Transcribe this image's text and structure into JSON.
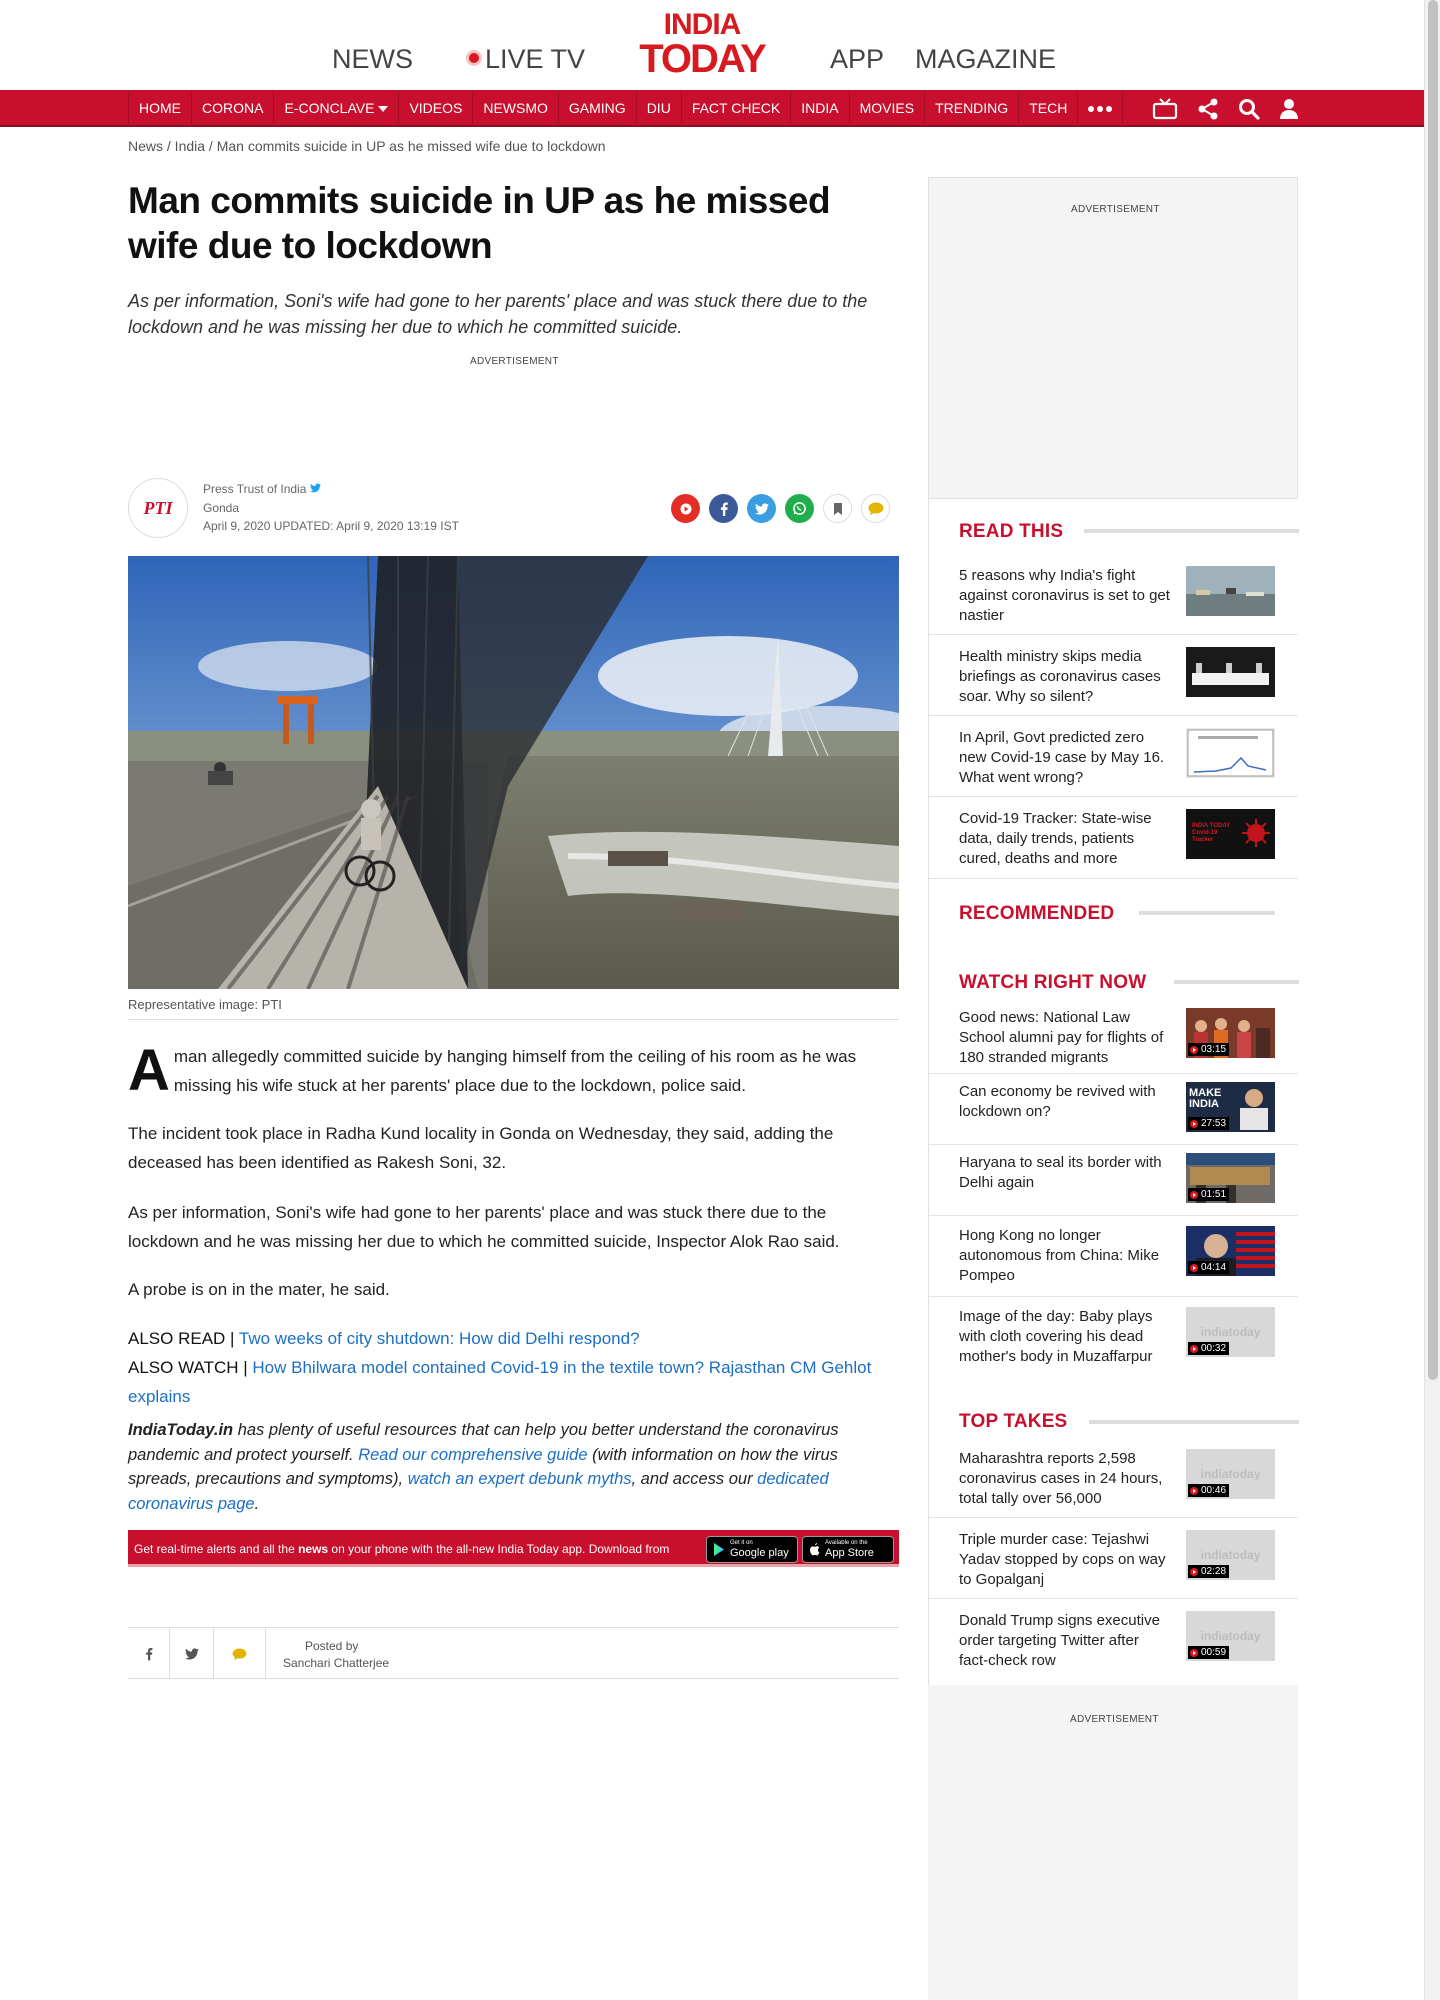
{
  "header": {
    "top_links": {
      "news": "NEWS",
      "live_tv": "LIVE TV",
      "app": "APP",
      "magazine": "MAGAZINE"
    },
    "logo": {
      "line1": "INDIA",
      "line2": "TODAY"
    },
    "brand_color": "#c8102e",
    "nav": [
      "HOME",
      "CORONA",
      "E-CONCLAVE",
      "VIDEOS",
      "NEWSMO",
      "GAMING",
      "DIU",
      "FACT CHECK",
      "INDIA",
      "MOVIES",
      "TRENDING",
      "TECH"
    ],
    "nav_icons": [
      "tv-icon",
      "share-icon",
      "search-icon",
      "user-icon"
    ]
  },
  "breadcrumb": "News / India / Man commits suicide in UP as he missed wife due to lockdown",
  "article": {
    "headline": "Man commits suicide in UP as he missed wife due to lockdown",
    "summary": "As per information, Soni's wife had gone to her parents' place and was stuck there due to the lockdown and he was missing her due to which he committed suicide.",
    "ad_label": "ADVERTISEMENT",
    "author": {
      "logo_text": "PTI",
      "name": "Press Trust of India",
      "location": "Gonda",
      "dateline": "April 9, 2020  UPDATED: April 9, 2020 13:19 IST"
    },
    "share_icons": [
      "youtube-icon",
      "facebook-icon",
      "twitter-icon",
      "whatsapp-icon",
      "bookmark-icon",
      "comment-icon"
    ],
    "image_caption": "Representative image: PTI",
    "dropcap": "A",
    "p1": "man allegedly committed suicide by hanging himself from the ceiling of his room as he was missing his wife stuck at her parents' place due to the lockdown, police said.",
    "p2": "The incident took place in Radha Kund locality in Gonda on Wednesday, they said, adding the deceased has been identified as Rakesh Soni, 32.",
    "p3": "As per information, Soni's wife had gone to her parents' place and was stuck there due to the lockdown and he was missing her due to which he committed suicide, Inspector Alok Rao said.",
    "p4": "A probe is on in the mater, he said.",
    "also_read_label": "ALSO READ |",
    "also_read_link": "Two weeks of city shutdown: How did Delhi respond?",
    "also_watch_label": "ALSO WATCH |",
    "also_watch_link": "How Bhilwara model contained Covid-19 in the textile town? Rajasthan CM Gehlot explains",
    "resources": {
      "brand": "IndiaToday.in",
      "t1": " has plenty of useful resources that can help you better understand the coronavirus pandemic and protect yourself. ",
      "link1": "Read our comprehensive guide",
      "t2": " (with information on how the virus spreads, precautions and symptoms), ",
      "link2": "watch an expert debunk myths",
      "t3": ", and access our ",
      "link3": "dedicated coronavirus page",
      "t4": "."
    },
    "app_bar": {
      "text_before": "Get real-time alerts and all the ",
      "text_bold": "news",
      "text_after": " on your phone with the all-new India Today app. Download from",
      "google_small": "Get it on",
      "google_big": "Google play",
      "apple_small": "Available on the",
      "apple_big": "App Store"
    },
    "posted_by_label": "Posted by",
    "posted_by_name": "Sanchari Chatterjee"
  },
  "sidebar": {
    "ad_label": "ADVERTISEMENT",
    "read_this": {
      "heading": "READ THIS",
      "items": [
        {
          "title": "5 reasons why India's fight against coronavirus is set to get nastier"
        },
        {
          "title": "Health ministry skips media briefings as coronavirus cases soar. Why so silent?"
        },
        {
          "title": "In April, Govt predicted zero new Covid-19 case by May 16. What went wrong?"
        },
        {
          "title": "Covid-19 Tracker: State-wise data, daily trends, patients cured, deaths and more"
        }
      ]
    },
    "recommended_heading": "RECOMMENDED",
    "watch": {
      "heading": "WATCH RIGHT NOW",
      "items": [
        {
          "title": "Good news: National Law School alumni pay for flights of 180 stranded migrants",
          "duration": "03:15"
        },
        {
          "title": "Can economy be revived with lockdown on?",
          "duration": "27:53"
        },
        {
          "title": "Haryana to seal its border with Delhi again",
          "duration": "01:51"
        },
        {
          "title": "Hong Kong no longer autonomous from China: Mike Pompeo",
          "duration": "04:14"
        },
        {
          "title": "Image of the day: Baby plays with cloth covering his dead mother's body in Muzaffarpur",
          "duration": "00:32"
        }
      ]
    },
    "top_takes": {
      "heading": "TOP TAKES",
      "items": [
        {
          "title": "Maharashtra reports 2,598 coronavirus cases in 24 hours, total tally over 56,000",
          "duration": "00:46"
        },
        {
          "title": "Triple murder case: Tejashwi Yadav stopped by cops on way to Gopalganj",
          "duration": "02:28"
        },
        {
          "title": "Donald Trump signs executive order targeting Twitter after fact-check row",
          "duration": "00:59"
        }
      ]
    },
    "thumb_watermark": "indiatoday",
    "tracker_thumb_text": "INDIA TODAY Covid-19 Tracker",
    "make_in_india_text": "MAKE INDIA"
  }
}
